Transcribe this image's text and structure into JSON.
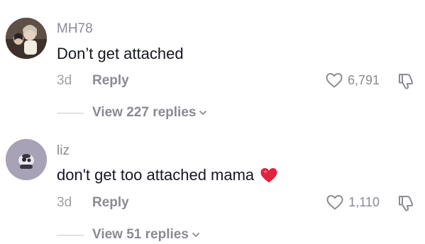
{
  "comments": [
    {
      "username": "MH78",
      "text": "Don’t get attached",
      "age": "3d",
      "reply_label": "Reply",
      "likes": "6,791",
      "view_replies": "View 227 replies",
      "avatar_icon": "avatar-photo-icon"
    },
    {
      "username": "liz",
      "text": "don't get too attached mama",
      "emoji": "red-heart-emoji",
      "age": "3d",
      "reply_label": "Reply",
      "likes": "1,110",
      "view_replies": "View 51 replies",
      "avatar_icon": "avatar-photo-icon"
    }
  ],
  "colors": {
    "primary_text": "#161823",
    "secondary_text": "#8a8b91",
    "heart_red": "#e0243d"
  }
}
